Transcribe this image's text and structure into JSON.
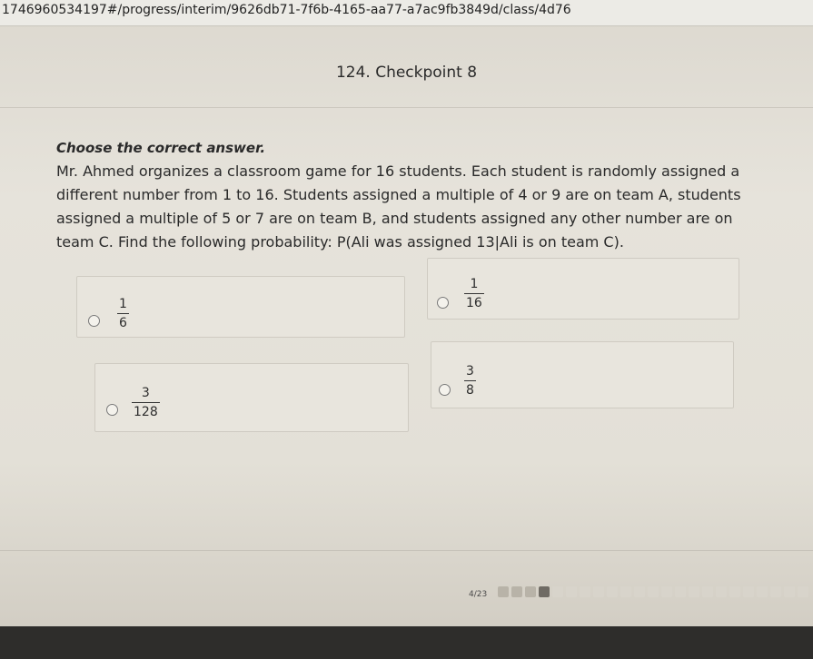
{
  "url": "1746960534197#/progress/interim/9626db71-7f6b-4165-aa77-a7ac9fb3849d/class/4d76",
  "page": {
    "title": "124. Checkpoint 8"
  },
  "question": {
    "instruction": "Choose the correct answer.",
    "text": "Mr. Ahmed organizes a classroom game for 16 students. Each student is randomly assigned a different number from 1 to 16. Students assigned a multiple of 4 or 9 are on team A, students assigned a multiple of 5 or 7 are on team B, and students assigned any other number are on team C. Find the following probability: P(Ali was assigned 13|Ali is on team C)."
  },
  "options": [
    {
      "numerator": "1",
      "denominator": "6"
    },
    {
      "numerator": "1",
      "denominator": "16"
    },
    {
      "numerator": "3",
      "denominator": "128"
    },
    {
      "numerator": "3",
      "denominator": "8"
    }
  ],
  "progress": {
    "text": "4/23",
    "completed": 3,
    "current": 4,
    "total": 23
  }
}
